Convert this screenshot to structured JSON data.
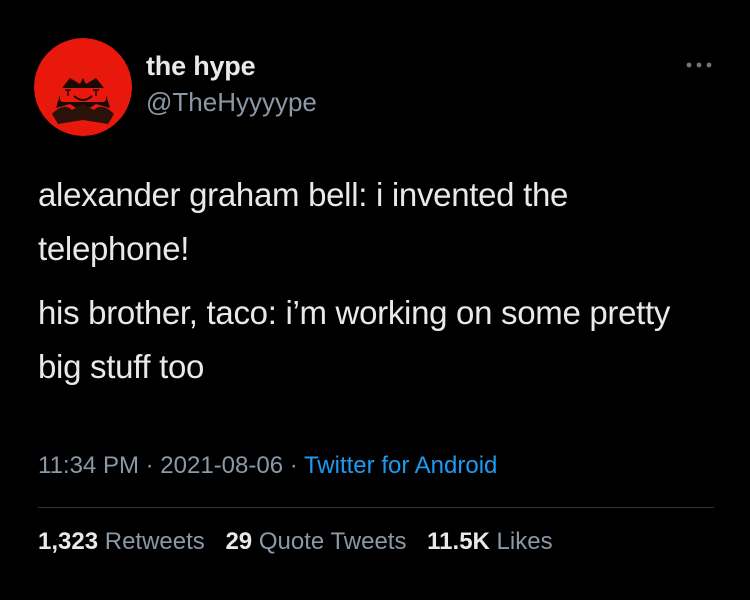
{
  "user": {
    "name": "the hype",
    "handle": "@TheHyyyype"
  },
  "tweet": {
    "paragraphs": [
      "alexander graham bell: i invented the telephone!",
      "his brother, taco: i’m working on some pretty big stuff too"
    ]
  },
  "meta": {
    "time": "11:34 PM",
    "separator": "·",
    "date": "2021-08-06",
    "source": "Twitter for Android"
  },
  "stats": {
    "retweets_count": "1,323",
    "retweets_label": "Retweets",
    "quotes_count": "29",
    "quotes_label": "Quote Tweets",
    "likes_count": "11.5K",
    "likes_label": "Likes"
  },
  "icons": {
    "more": "more-horizontal-icon",
    "avatar": "avatar-icon"
  },
  "colors": {
    "background": "#000000",
    "text": "#e7e9ea",
    "secondary": "#8b98a5",
    "link": "#1d9bf0",
    "avatar": "#e8180c"
  }
}
